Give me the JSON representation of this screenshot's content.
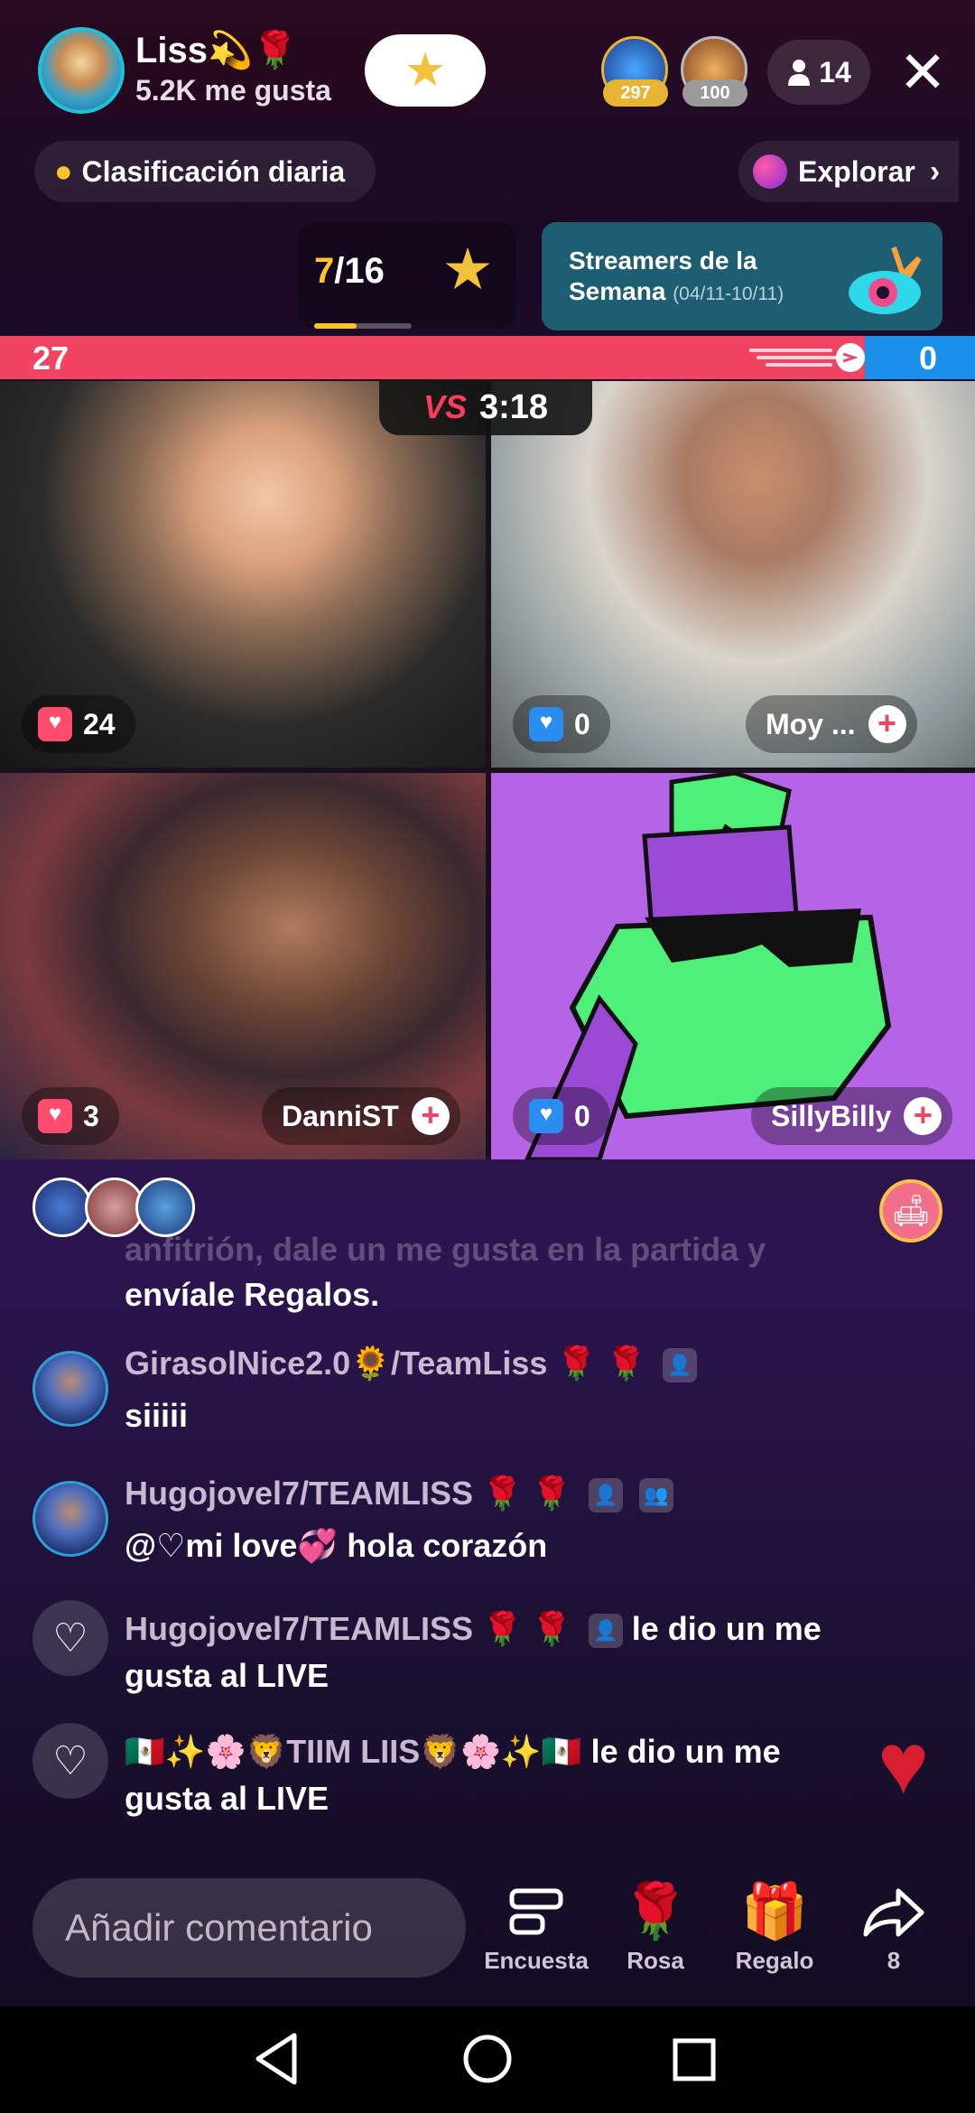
{
  "header": {
    "host_name": "Liss💫🌹",
    "host_likes": "5.2K me gusta",
    "follow_icon": "star-icon",
    "top_supporters": [
      {
        "badge": "297",
        "color": "#e7b533"
      },
      {
        "badge": "100",
        "color": "#b9b9b9"
      }
    ],
    "viewer_count": "14",
    "close_icon": "close-icon"
  },
  "ranking": {
    "daily_label": "Clasificación diaria",
    "explore_label": "Explorar",
    "counter_current": "7",
    "counter_total": "/16",
    "counter_progress": 0.4375,
    "weekly_title": "Streamers de la Semana",
    "weekly_date": "(04/11-10/11)"
  },
  "pk": {
    "left_score": "27",
    "right_score": "0",
    "timer": "3:18",
    "vs_label": "VS",
    "left_color": "#f04462",
    "right_color": "#1b8fea"
  },
  "tiles": [
    {
      "gift_count": "24",
      "gift_color": "red",
      "name": ""
    },
    {
      "gift_count": "0",
      "gift_color": "blue",
      "name": "Moy ..."
    },
    {
      "gift_count": "3",
      "gift_color": "red",
      "name": "DanniST"
    },
    {
      "gift_count": "0",
      "gift_color": "blue",
      "name": "SillyBilly"
    }
  ],
  "chat": {
    "faded_line": "anfitrión, dale un me gusta en la partida y",
    "system_line": "envíale Regalos.",
    "messages": [
      {
        "name": "GirasolNice2.0🌻/TeamLiss",
        "text": "siiiii"
      },
      {
        "name": "Hugojovel7/TEAMLISS",
        "text": "@♡mi love💞 hola corazón"
      }
    ],
    "likes": [
      {
        "name": "Hugojovel7/TEAMLISS",
        "action": "le dio un me",
        "action2": "gusta al LIVE"
      },
      {
        "name": "🇲🇽✨🌸🦁TIIM LIIS🦁🌸✨🇲🇽",
        "action": "le dio un me",
        "action2": "gusta al LIVE"
      }
    ]
  },
  "bottom": {
    "comment_placeholder": "Añadir comentario",
    "tools": [
      {
        "label": "Encuesta",
        "icon": "poll-icon"
      },
      {
        "label": "Rosa",
        "icon": "rose-icon"
      },
      {
        "label": "Regalo",
        "icon": "gift-icon"
      },
      {
        "label": "8",
        "icon": "share-icon"
      }
    ]
  }
}
